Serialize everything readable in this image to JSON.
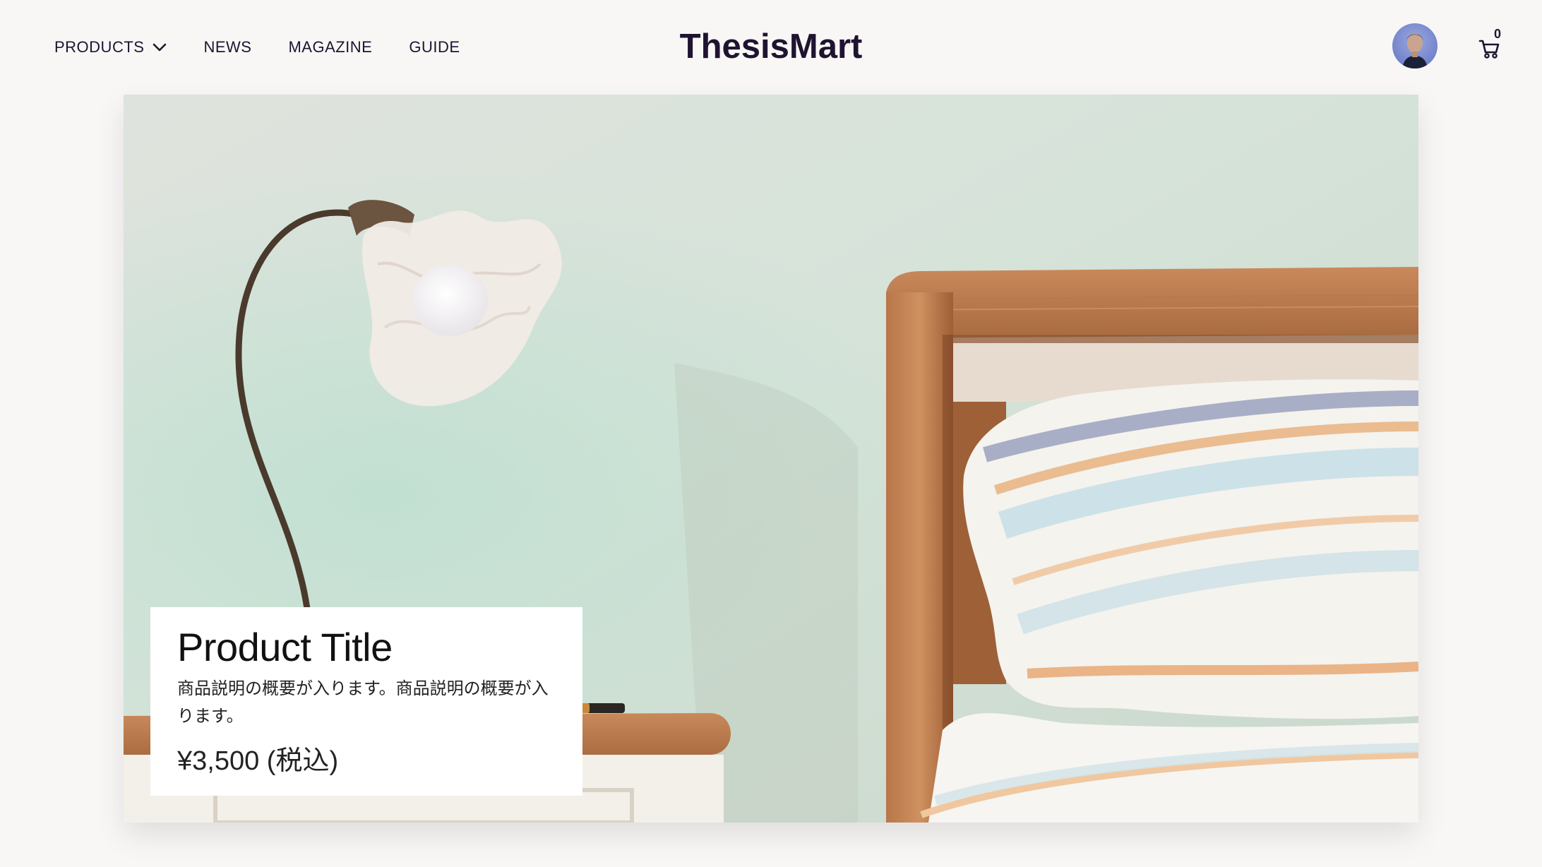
{
  "header": {
    "brand": "ThesisMart",
    "nav": [
      {
        "label": "PRODUCTS",
        "has_dropdown": true
      },
      {
        "label": "NEWS"
      },
      {
        "label": "MAGAZINE"
      },
      {
        "label": "GUIDE"
      }
    ],
    "cart_count": "0"
  },
  "hero": {
    "product_title": "Product Title",
    "product_description": "商品説明の概要が入ります。商品説明の概要が入ります。",
    "product_price": "¥3,500 (税込)"
  },
  "colors": {
    "page_bg": "#f8f7f6",
    "brand_text": "#1f1430",
    "card_bg": "#ffffff"
  }
}
